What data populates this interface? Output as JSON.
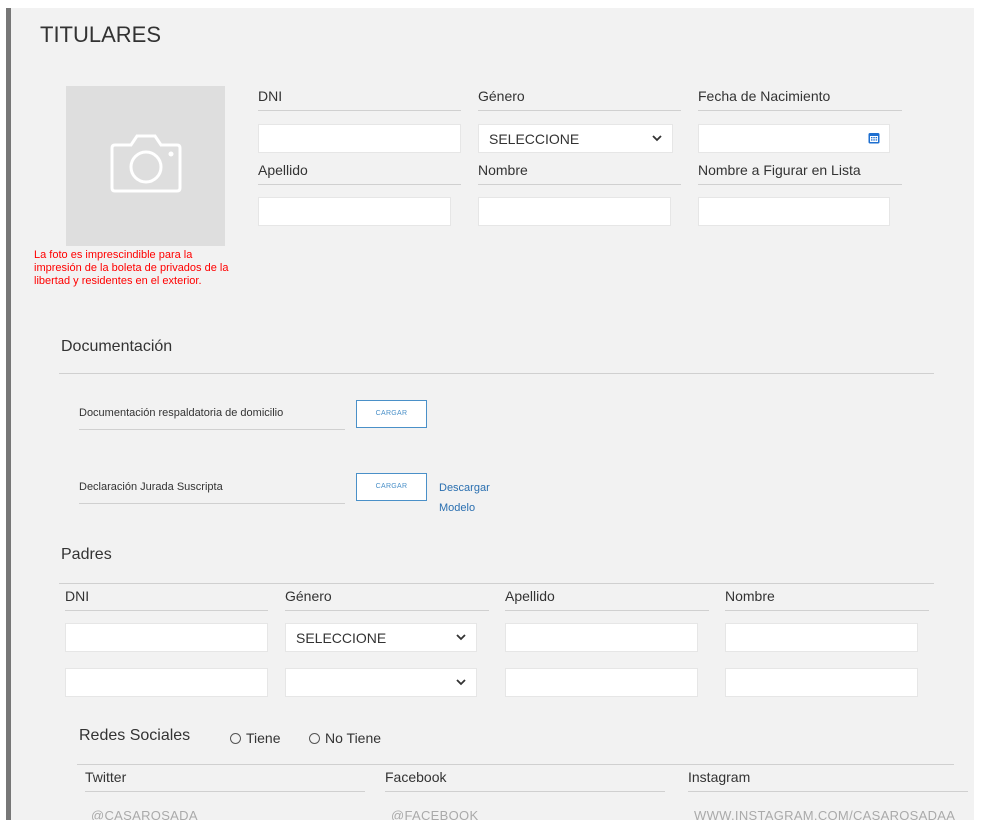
{
  "titulares": {
    "title": "TITULARES",
    "photo_warning": "La foto es imprescindible para la impresión de la boleta de privados de la libertad y residentes en el exterior.",
    "fields": {
      "dni_label": "DNI",
      "genero_label": "Género",
      "genero_value": "SELECCIONE",
      "fecha_label": "Fecha de Nacimiento",
      "apellido_label": "Apellido",
      "nombre_label": "Nombre",
      "nombre_lista_label": "Nombre a Figurar en Lista"
    }
  },
  "documentacion": {
    "title": "Documentación",
    "rows": [
      {
        "label": "Documentación respaldatoria de domicilio",
        "button": "CARGAR"
      },
      {
        "label": "Declaración Jurada Suscripta",
        "button": "CARGAR",
        "link": "Descargar Modelo"
      }
    ]
  },
  "padres": {
    "title": "Padres",
    "columns": [
      "DNI",
      "Género",
      "Apellido",
      "Nombre"
    ],
    "rows": [
      {
        "genero": "SELECCIONE"
      },
      {
        "genero": ""
      }
    ]
  },
  "redes": {
    "title": "Redes Sociales",
    "options": [
      "Tiene",
      "No Tiene"
    ],
    "columns": [
      "Twitter",
      "Facebook",
      "Instagram"
    ],
    "placeholders": [
      "@CASAROSADA",
      "@FACEBOOK",
      "WWW.INSTAGRAM.COM/CASAROSADAA"
    ]
  },
  "colors": {
    "panel_bg": "#f2f2f2",
    "warning": "#ff0000",
    "accent": "#4a90c8"
  },
  "icons": [
    "camera-icon",
    "calendar-icon",
    "chevron-down-icon",
    "radio-icon"
  ]
}
